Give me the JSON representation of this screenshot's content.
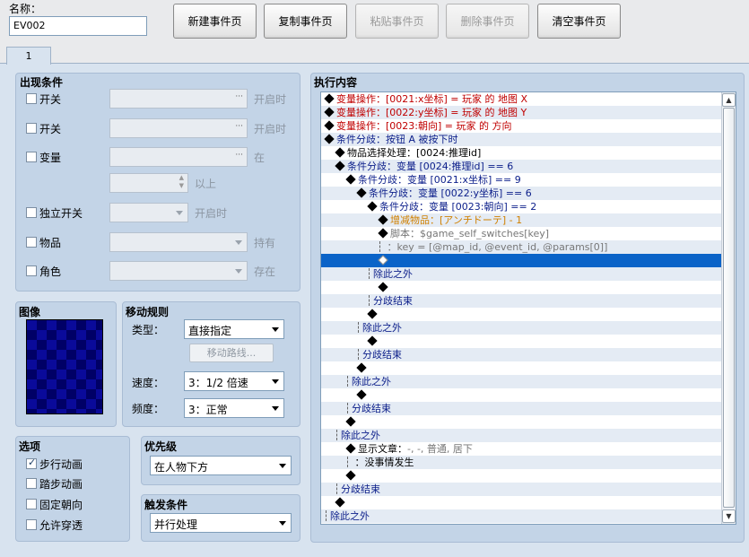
{
  "header": {
    "name_label": "名称：",
    "name_value": "EV002"
  },
  "toolbar": {
    "new": "新建事件页",
    "copy": "复制事件页",
    "paste": "粘贴事件页",
    "delete": "删除事件页",
    "clear": "清空事件页"
  },
  "tab": {
    "label": "1"
  },
  "conditions": {
    "title": "出现条件",
    "switch1": "开关",
    "switch1_suffix": "开启时",
    "switch2": "开关",
    "switch2_suffix": "开启时",
    "variable": "变量",
    "variable_suffix": "在",
    "variable_suffix2": "以上",
    "self_switch": "独立开关",
    "self_switch_suffix": "开启时",
    "item": "物品",
    "item_suffix": "持有",
    "actor": "角色",
    "actor_suffix": "存在"
  },
  "image": {
    "title": "图像"
  },
  "movement": {
    "title": "移动规则",
    "type_label": "类型：",
    "type_value": "直接指定",
    "route_button": "移动路线...",
    "speed_label": "速度：",
    "speed_value": "3：1/2 倍速",
    "freq_label": "频度：",
    "freq_value": "3：正常"
  },
  "options": {
    "title": "选项",
    "walk": "步行动画",
    "step": "踏步动画",
    "fixdir": "固定朝向",
    "through": "允许穿透",
    "walk_checked": true,
    "step_checked": false,
    "fixdir_checked": false,
    "through_checked": false
  },
  "priority": {
    "title": "优先级",
    "value": "在人物下方"
  },
  "trigger": {
    "title": "触发条件",
    "value": "并行处理"
  },
  "contents": {
    "title": "执行内容",
    "rows": [
      {
        "indent": 0,
        "mark": "dia",
        "parts": [
          {
            "c": "red",
            "t": "变量操作：[0021:x坐标] = 玩家 的 地图 X"
          }
        ]
      },
      {
        "indent": 0,
        "mark": "dia",
        "parts": [
          {
            "c": "red",
            "t": "变量操作：[0022:y坐标] = 玩家 的 地图 Y"
          }
        ]
      },
      {
        "indent": 0,
        "mark": "dia",
        "parts": [
          {
            "c": "red",
            "t": "变量操作：[0023:朝向] = 玩家 的 方向"
          }
        ]
      },
      {
        "indent": 0,
        "mark": "dia",
        "parts": [
          {
            "c": "blue",
            "t": "条件分歧：按钮 A 被按下时"
          }
        ]
      },
      {
        "indent": 1,
        "mark": "dia",
        "parts": [
          {
            "c": "blk",
            "t": "物品选择处理：[0024:推理id]"
          }
        ]
      },
      {
        "indent": 1,
        "mark": "dia",
        "parts": [
          {
            "c": "blue",
            "t": "条件分歧：变量 [0024:推理id] == 6"
          }
        ]
      },
      {
        "indent": 2,
        "mark": "dia",
        "parts": [
          {
            "c": "blue",
            "t": "条件分歧：变量 [0021:x坐标] == 9"
          }
        ]
      },
      {
        "indent": 3,
        "mark": "dia",
        "parts": [
          {
            "c": "blue",
            "t": "条件分歧：变量 [0022:y坐标] == 6"
          }
        ]
      },
      {
        "indent": 4,
        "mark": "dia",
        "parts": [
          {
            "c": "blue",
            "t": "条件分歧：变量 [0023:朝向] == 2"
          }
        ]
      },
      {
        "indent": 5,
        "mark": "dia",
        "parts": [
          {
            "c": "orange",
            "t": "增减物品：[アンチドーテ] - 1"
          }
        ]
      },
      {
        "indent": 5,
        "mark": "dia",
        "parts": [
          {
            "c": "dgray",
            "t": "脚本：$game_self_switches[key]"
          }
        ]
      },
      {
        "indent": 5,
        "mark": "bar",
        "parts": [
          {
            "c": "dgray",
            "t": "    ：key = [@map_id, @event_id, @params[0]]"
          }
        ]
      },
      {
        "indent": 5,
        "mark": "wdia",
        "parts": [],
        "selected": true
      },
      {
        "indent": 4,
        "mark": "bar",
        "parts": [
          {
            "c": "blue",
            "t": "除此之外"
          }
        ]
      },
      {
        "indent": 5,
        "mark": "dia",
        "parts": []
      },
      {
        "indent": 4,
        "mark": "bar",
        "parts": [
          {
            "c": "blue",
            "t": "分歧结束"
          }
        ]
      },
      {
        "indent": 4,
        "mark": "dia",
        "parts": []
      },
      {
        "indent": 3,
        "mark": "bar",
        "parts": [
          {
            "c": "blue",
            "t": "除此之外"
          }
        ]
      },
      {
        "indent": 4,
        "mark": "dia",
        "parts": []
      },
      {
        "indent": 3,
        "mark": "bar",
        "parts": [
          {
            "c": "blue",
            "t": "分歧结束"
          }
        ]
      },
      {
        "indent": 3,
        "mark": "dia",
        "parts": []
      },
      {
        "indent": 2,
        "mark": "bar",
        "parts": [
          {
            "c": "blue",
            "t": "除此之外"
          }
        ]
      },
      {
        "indent": 3,
        "mark": "dia",
        "parts": []
      },
      {
        "indent": 2,
        "mark": "bar",
        "parts": [
          {
            "c": "blue",
            "t": "分歧结束"
          }
        ]
      },
      {
        "indent": 2,
        "mark": "dia",
        "parts": []
      },
      {
        "indent": 1,
        "mark": "bar",
        "parts": [
          {
            "c": "blue",
            "t": "除此之外"
          }
        ]
      },
      {
        "indent": 2,
        "mark": "dia",
        "parts": [
          {
            "c": "blk",
            "t": "显示文章："
          },
          {
            "c": "dgray",
            "t": "-, -, 普通, 居下"
          }
        ]
      },
      {
        "indent": 2,
        "mark": "bar",
        "parts": [
          {
            "c": "blk",
            "t": "          ：没事情发生"
          }
        ]
      },
      {
        "indent": 2,
        "mark": "dia",
        "parts": []
      },
      {
        "indent": 1,
        "mark": "bar",
        "parts": [
          {
            "c": "blue",
            "t": "分歧结束"
          }
        ]
      },
      {
        "indent": 1,
        "mark": "dia",
        "parts": []
      },
      {
        "indent": 0,
        "mark": "bar",
        "parts": [
          {
            "c": "blue",
            "t": "除此之外"
          }
        ]
      }
    ]
  }
}
